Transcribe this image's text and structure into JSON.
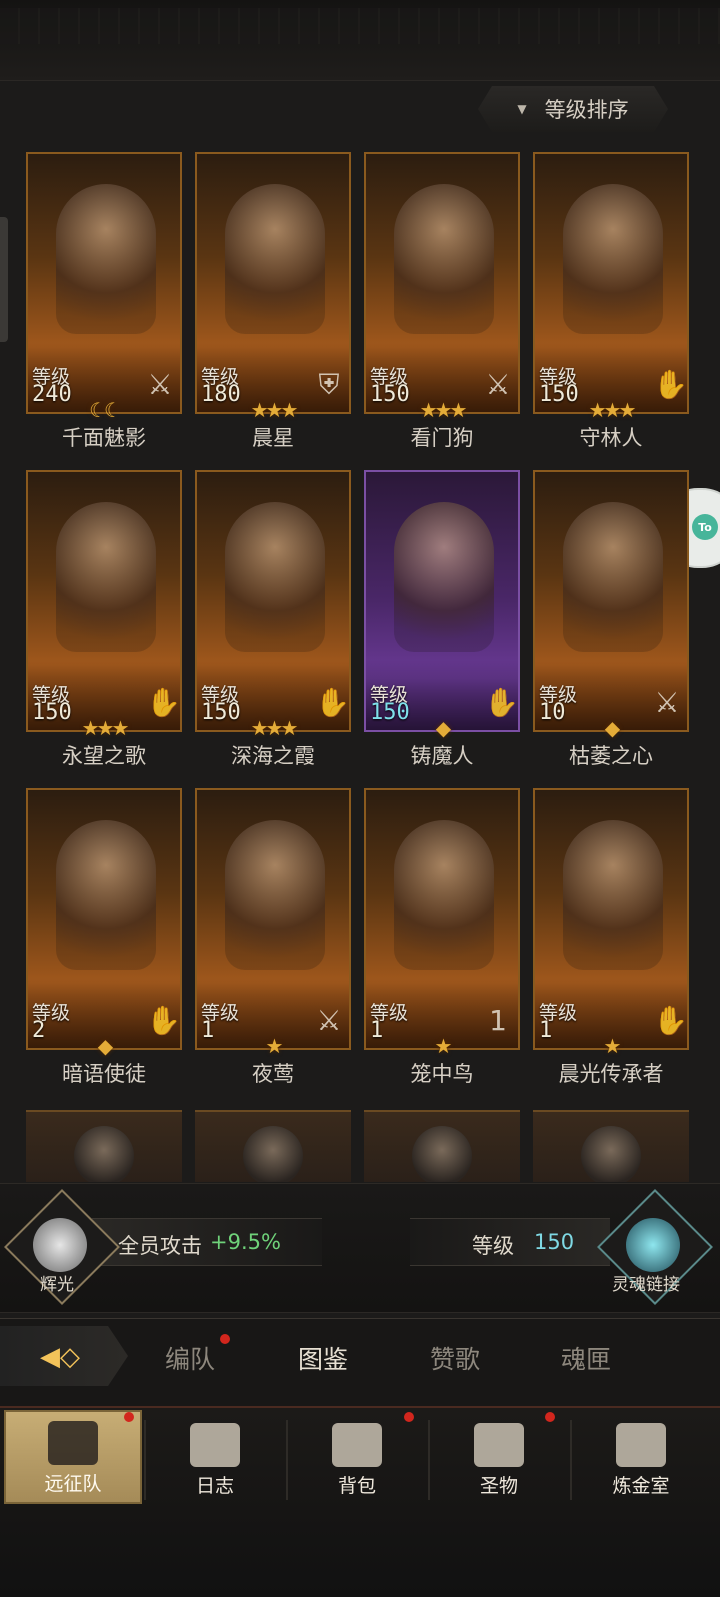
{
  "sort_button": {
    "label": "等级排序"
  },
  "level_label": "等级",
  "heroes": [
    {
      "name": "千面魅影",
      "level": "240",
      "stars": "☾☾",
      "role": "sword-icon",
      "role_glyph": "⚔",
      "frame": "gold"
    },
    {
      "name": "晨星",
      "level": "180",
      "stars": "★★★",
      "role": "shield-icon",
      "role_glyph": "⛨",
      "frame": "gold"
    },
    {
      "name": "看门狗",
      "level": "150",
      "stars": "★★★",
      "role": "sword-icon",
      "role_glyph": "⚔",
      "frame": "gold"
    },
    {
      "name": "守林人",
      "level": "150",
      "stars": "★★★",
      "role": "hand-icon",
      "role_glyph": "✋",
      "frame": "gold"
    },
    {
      "name": "永望之歌",
      "level": "150",
      "stars": "★★★",
      "role": "hand-icon",
      "role_glyph": "✋",
      "frame": "gold"
    },
    {
      "name": "深海之霞",
      "level": "150",
      "stars": "★★★",
      "role": "hand-icon",
      "role_glyph": "✋",
      "frame": "gold"
    },
    {
      "name": "铸魔人",
      "level": "150",
      "stars": "◆",
      "role": "hand-icon",
      "role_glyph": "✋",
      "frame": "purple"
    },
    {
      "name": "枯萎之心",
      "level": "10",
      "stars": "◆",
      "role": "sword-icon",
      "role_glyph": "⚔",
      "frame": "gold"
    },
    {
      "name": "暗语使徒",
      "level": "2",
      "stars": "◆",
      "role": "hand-icon",
      "role_glyph": "✋",
      "frame": "gold"
    },
    {
      "name": "夜莺",
      "level": "1",
      "stars": "★",
      "role": "sword-icon",
      "role_glyph": "⚔",
      "frame": "gold"
    },
    {
      "name": "笼中鸟",
      "level": "1",
      "stars": "★",
      "role": "hammer-badge-icon",
      "role_glyph": "1",
      "frame": "gold"
    },
    {
      "name": "晨光传承者",
      "level": "1",
      "stars": "★",
      "role": "hand-icon",
      "role_glyph": "✋",
      "frame": "gold"
    }
  ],
  "bonus": {
    "left_emblem_label": "辉光",
    "stat_label": "全员攻击",
    "stat_value": "+9.5%",
    "right_level_label": "等级",
    "right_level_value": "150",
    "right_emblem_label": "灵魂链接"
  },
  "tabs": [
    {
      "label": "编队",
      "badge": true
    },
    {
      "label": "图鉴",
      "active": true
    },
    {
      "label": "赞歌"
    },
    {
      "label": "魂匣"
    }
  ],
  "nav": [
    {
      "label": "远征队",
      "active": true,
      "badge": true
    },
    {
      "label": "日志"
    },
    {
      "label": "背包",
      "badge": true
    },
    {
      "label": "圣物",
      "badge": true
    },
    {
      "label": "炼金室"
    }
  ],
  "colors": {
    "accent_gold": "#e4ac38",
    "stat_green": "#6fd27a",
    "level_cyan": "#7fd9e4",
    "badge_red": "#d2261d"
  }
}
